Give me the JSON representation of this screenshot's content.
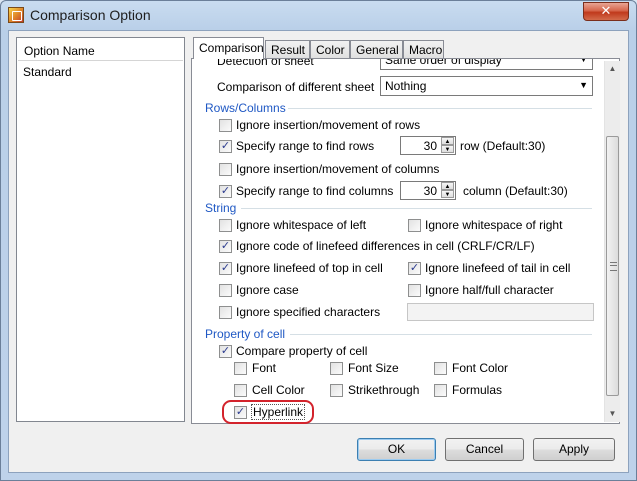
{
  "window": {
    "title": "Comparison Option",
    "close_glyph": "✕"
  },
  "option_list": {
    "header": "Option Name",
    "items": [
      "Standard"
    ]
  },
  "tabs": [
    "Comparison",
    "Result",
    "Color",
    "General",
    "Macro"
  ],
  "detection_of_sheet": {
    "label": "Detection of sheet",
    "value": "Same order of display"
  },
  "comparison_of_different_sheet": {
    "label": "Comparison of different sheet",
    "value": "Nothing"
  },
  "rows_columns": {
    "title": "Rows/Columns",
    "ignore_rows": {
      "label": "Ignore insertion/movement of rows",
      "checked": false
    },
    "specify_rows": {
      "label": "Specify range to find rows",
      "checked": true,
      "value": "30",
      "suffix": "row (Default:30)"
    },
    "ignore_columns": {
      "label": "Ignore insertion/movement of columns",
      "checked": false
    },
    "specify_columns": {
      "label": "Specify range to find columns",
      "checked": true,
      "value": "30",
      "suffix": "column (Default:30)"
    }
  },
  "string": {
    "title": "String",
    "ws_left": {
      "label": "Ignore whitespace of left",
      "checked": false
    },
    "ws_right": {
      "label": "Ignore whitespace of right",
      "checked": false
    },
    "linefeed_code": {
      "label": "Ignore code of linefeed differences in cell (CRLF/CR/LF)",
      "checked": true
    },
    "linefeed_top": {
      "label": "Ignore linefeed of top in cell",
      "checked": true
    },
    "linefeed_tail": {
      "label": "Ignore linefeed of tail in cell",
      "checked": true
    },
    "case": {
      "label": "Ignore case",
      "checked": false
    },
    "half_full": {
      "label": "Ignore half/full character",
      "checked": false
    },
    "specified": {
      "label": "Ignore specified characters",
      "checked": false,
      "value": ""
    }
  },
  "property_of_cell": {
    "title": "Property of cell",
    "compare": {
      "label": "Compare property of cell",
      "checked": true
    },
    "font": {
      "label": "Font",
      "checked": false
    },
    "font_size": {
      "label": "Font Size",
      "checked": false
    },
    "font_color": {
      "label": "Font Color",
      "checked": false
    },
    "cell_color": {
      "label": "Cell Color",
      "checked": false
    },
    "strikethrough": {
      "label": "Strikethrough",
      "checked": false
    },
    "formulas": {
      "label": "Formulas",
      "checked": false
    },
    "hyperlink": {
      "label": "Hyperlink",
      "checked": true
    }
  },
  "buttons": {
    "ok": "OK",
    "cancel": "Cancel",
    "apply": "Apply"
  },
  "glyphs": {
    "check": "✓",
    "dropdown": "▼",
    "spin_up": "▲",
    "spin_down": "▼",
    "scroll_up": "▲",
    "scroll_down": "▼"
  },
  "colors": {
    "group_title": "#1f58c4",
    "highlight": "#d3232c"
  }
}
